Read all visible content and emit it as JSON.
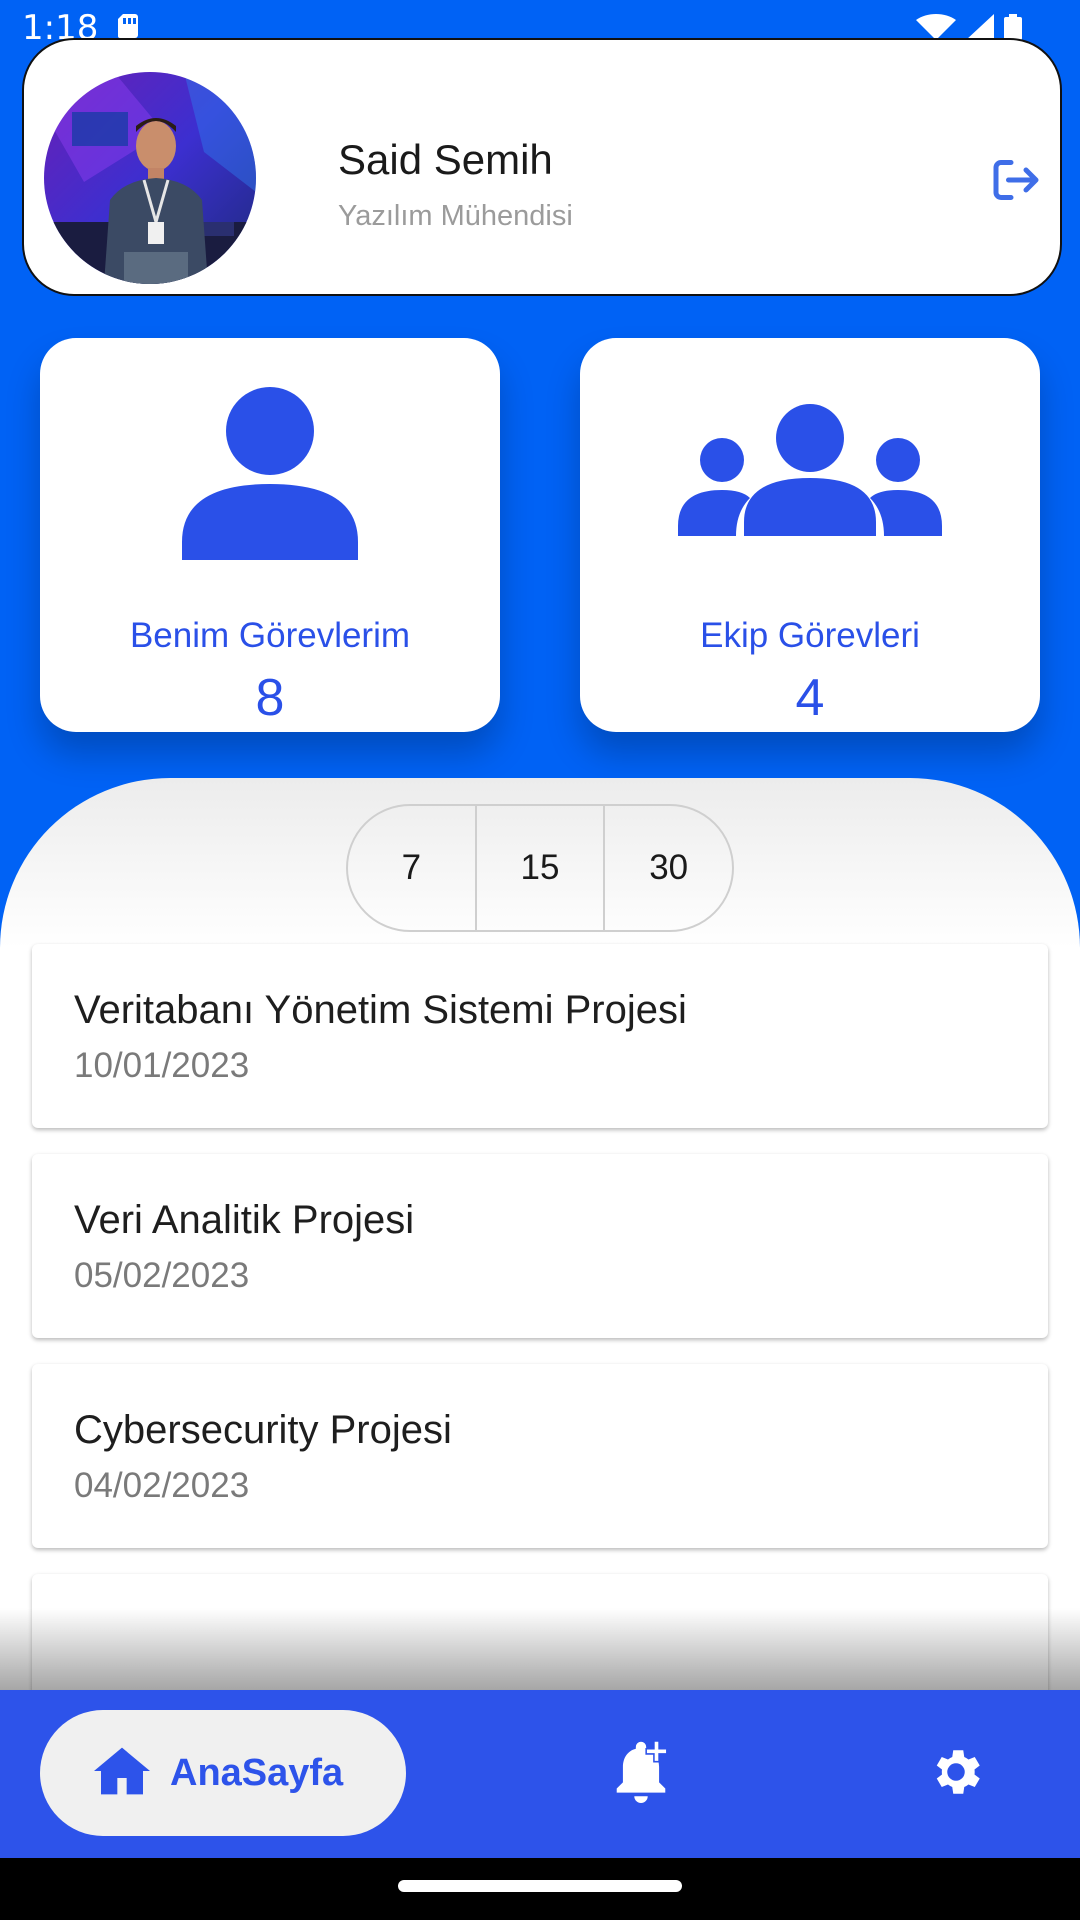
{
  "status_bar": {
    "time": "1:18"
  },
  "profile": {
    "name": "Said Semih",
    "role": "Yazılım Mühendisi"
  },
  "stats": {
    "my_tasks": {
      "label": "Benim Görevlerim",
      "count": "8"
    },
    "team_tasks": {
      "label": "Ekip Görevleri",
      "count": "4"
    }
  },
  "segment": {
    "options": [
      "7",
      "15",
      "30"
    ]
  },
  "tasks": [
    {
      "title": "Veritabanı Yönetim Sistemi Projesi",
      "date": "10/01/2023"
    },
    {
      "title": "Veri Analitik Projesi",
      "date": "05/02/2023"
    },
    {
      "title": "Cybersecurity Projesi",
      "date": "04/02/2023"
    }
  ],
  "bottom_nav": {
    "home_label": "AnaSayfa",
    "icons": [
      "home-icon",
      "add-alert-icon",
      "gear-icon"
    ]
  },
  "colors": {
    "background": "#0062f5",
    "accent": "#2a50e8",
    "nav": "#2d53ea"
  }
}
